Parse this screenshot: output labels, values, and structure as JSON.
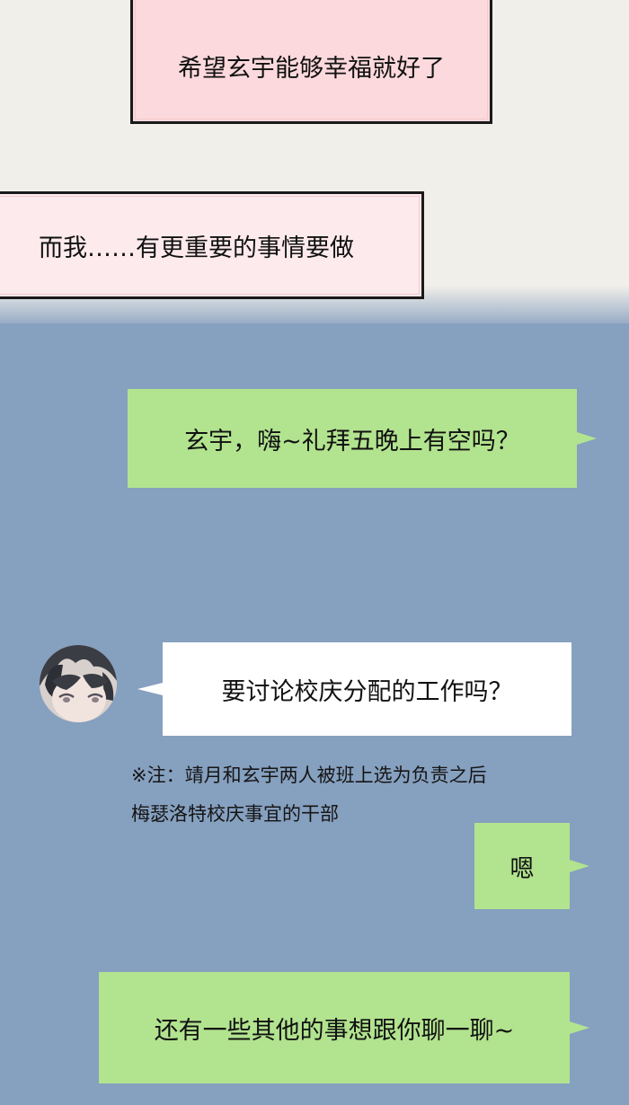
{
  "narration": {
    "line1": "希望玄宇能够幸福就好了",
    "line2": "而我……有更重要的事情要做"
  },
  "chat": {
    "messages": [
      {
        "text": "玄宇，嗨~礼拜五晚上有空吗？"
      },
      {
        "text": "要讨论校庆分配的工作吗？"
      },
      {
        "text": "嗯"
      },
      {
        "text": "还有一些其他的事想跟你聊一聊~"
      }
    ],
    "note_line1": "※注：靖月和玄宇两人被班上选为负责之后",
    "note_line2": "梅瑟洛特校庆事宜的干部"
  },
  "colors": {
    "top_background": "#f1efea",
    "chat_background": "#86a0bf",
    "sent_bubble": "#b2e38f",
    "received_bubble": "#ffffff",
    "narration_box": "#fcd9dc"
  },
  "icons": [
    "avatar"
  ]
}
